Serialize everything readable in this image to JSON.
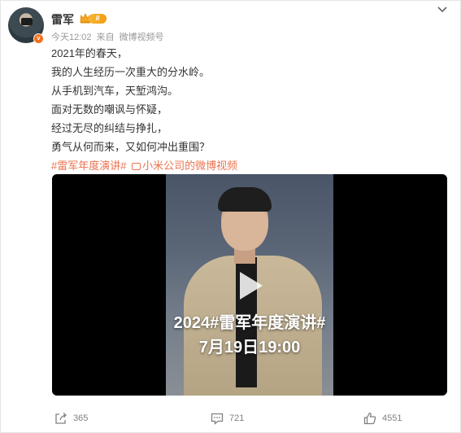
{
  "post": {
    "author": "雷军",
    "member_level": "II",
    "time": "今天12:02",
    "source_prefix": "来自",
    "source": "微博视频号",
    "lines": [
      "2021年的春天，",
      "我的人生经历一次重大的分水岭。",
      "从手机到汽车，天堑鸿沟。",
      "面对无数的嘲讽与怀疑，",
      "经过无尽的纠结与挣扎，",
      "勇气从何而来，又如何冲出重围？"
    ],
    "hashtag": "#雷军年度演讲#",
    "video_link": "小米公司的微博视频"
  },
  "video": {
    "overlay_title": "2024#雷军年度演讲#",
    "overlay_date": "7月19日19:00"
  },
  "actions": {
    "share_count": "365",
    "comment_count": "721",
    "like_count": "4551"
  },
  "colors": {
    "link": "#eb7350",
    "verified_badge": "#f56f1a",
    "muted_text": "#999999"
  },
  "icons": [
    "share-icon",
    "comment-icon",
    "like-icon",
    "chevron-down-icon",
    "play-icon",
    "verified-badge-icon"
  ]
}
